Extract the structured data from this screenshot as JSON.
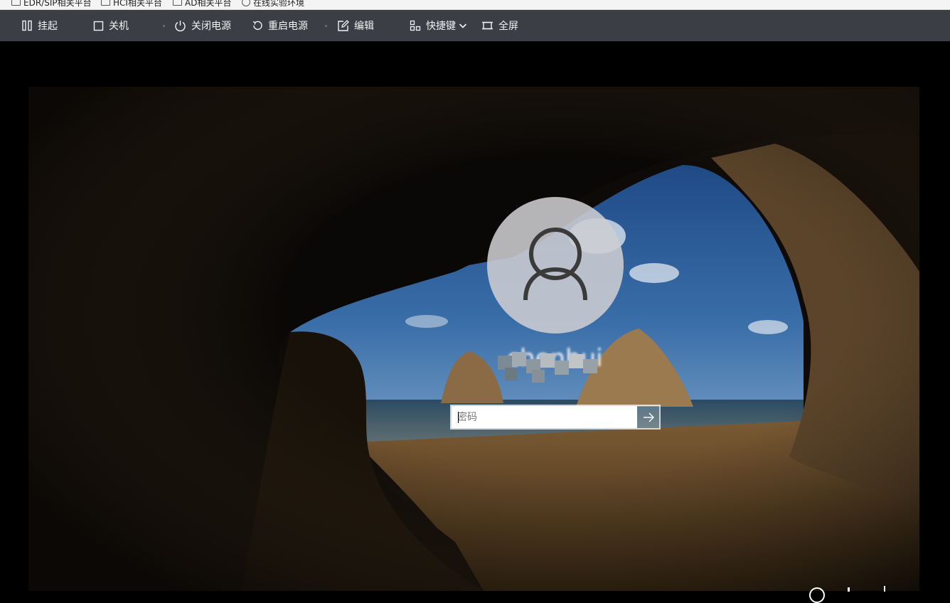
{
  "bookmarks": [
    {
      "label": "EDR/SIP相关平台",
      "icon": "folder-icon"
    },
    {
      "label": "HCI相关平台",
      "icon": "folder-icon"
    },
    {
      "label": "AD相关平台",
      "icon": "folder-icon"
    },
    {
      "label": "在线实验环境",
      "icon": "globe-icon"
    }
  ],
  "toolbar": {
    "suspend_label": "挂起",
    "shutdown_label": "关机",
    "power_off_label": "关闭电源",
    "restart_label": "重启电源",
    "edit_label": "编辑",
    "shortcuts_label": "快捷键",
    "fullscreen_label": "全屏"
  },
  "login": {
    "username": "chenhui",
    "password_placeholder": "密码"
  },
  "colors": {
    "toolbar_bg": "#3b3f45",
    "screen_bg": "#000000",
    "avatar_bg": "#cdcdd2"
  }
}
